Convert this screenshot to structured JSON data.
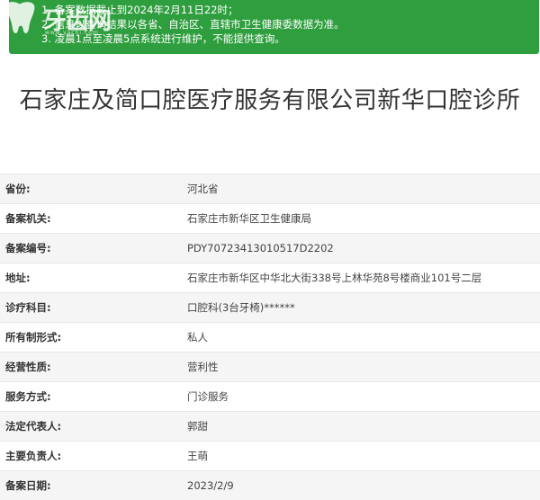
{
  "notice": {
    "lines": [
      "1. 备案数据截止到2024年2月11日22时；",
      "2. 信息以查询结果以各省、自治区、直辖市卫生健康委数据为准。",
      "3. 凌晨1点至凌晨5点系统进行维护，不能提供查询。"
    ],
    "background_color": "#2f9e3f"
  },
  "watermark": {
    "logo_text": "牙齿网",
    "logo_sub": "www.yachi.com",
    "icon": "tooth-icon"
  },
  "page_title": "石家庄及简口腔医疗服务有限公司新华口腔诊所",
  "details": [
    {
      "label": "省份:",
      "value": "河北省"
    },
    {
      "label": "备案机关:",
      "value": "石家庄市新华区卫生健康局"
    },
    {
      "label": "备案编号:",
      "value": "PDY70723413010517D2202"
    },
    {
      "label": "地址:",
      "value": "石家庄市新华区中华北大街338号上林华苑8号楼商业101号二层"
    },
    {
      "label": "诊疗科目:",
      "value": "口腔科(3台牙椅)******"
    },
    {
      "label": "所有制形式:",
      "value": "私人"
    },
    {
      "label": "经营性质:",
      "value": "营利性"
    },
    {
      "label": "服务方式:",
      "value": "门诊服务"
    },
    {
      "label": "法定代表人:",
      "value": "郭甜"
    },
    {
      "label": "主要负责人:",
      "value": "王萌"
    },
    {
      "label": "备案日期:",
      "value": "2023/2/9"
    }
  ]
}
